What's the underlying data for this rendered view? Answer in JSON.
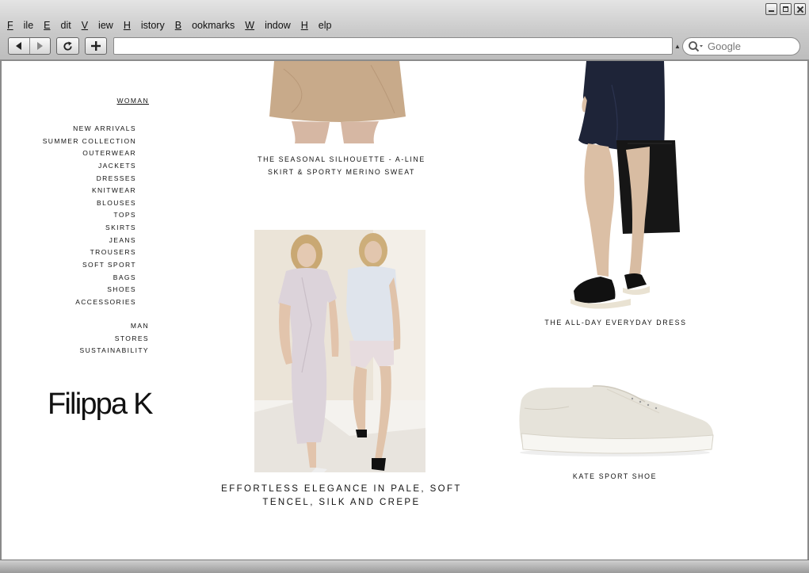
{
  "browser": {
    "menu": [
      {
        "label": "File"
      },
      {
        "label": "Edit"
      },
      {
        "label": "View"
      },
      {
        "label": "History"
      },
      {
        "label": "Bookmarks"
      },
      {
        "label": "Window"
      },
      {
        "label": "Help"
      }
    ],
    "url": "",
    "search_placeholder": "Google",
    "icons": {
      "back": "back-arrow-icon",
      "forward": "forward-arrow-icon",
      "reload": "reload-icon",
      "new_tab": "plus-icon",
      "search": "magnifier-icon"
    }
  },
  "site": {
    "nav_primary": "WOMAN",
    "categories": [
      "NEW ARRIVALS",
      "SUMMER COLLECTION",
      "OUTERWEAR",
      "JACKETS",
      "DRESSES",
      "KNITWEAR",
      "BLOUSES",
      "TOPS",
      "SKIRTS",
      "JEANS",
      "TROUSERS",
      "SOFT SPORT",
      "BAGS",
      "SHOES",
      "ACCESSORIES"
    ],
    "sections": [
      "MAN",
      "STORES",
      "SUSTAINABILITY"
    ],
    "logo": "Filippa K",
    "features": {
      "skirt": {
        "line1": "THE SEASONAL SILHOUETTE - A-LINE",
        "line2": "SKIRT & SPORTY MERINO SWEAT"
      },
      "dress": {
        "line1": "THE ALL-DAY EVERYDAY DRESS"
      },
      "elegance": {
        "line1": "EFFORTLESS ELEGANCE IN PALE, SOFT",
        "line2": "TENCEL, SILK AND CREPE"
      },
      "shoe": {
        "line1": "KATE SPORT SHOE"
      }
    }
  },
  "colors": {
    "text": "#111111",
    "chrome": "#c9c9c9",
    "skirt": "#c6a888",
    "dress": "#1e2438",
    "shoe": "#e6e3da"
  }
}
